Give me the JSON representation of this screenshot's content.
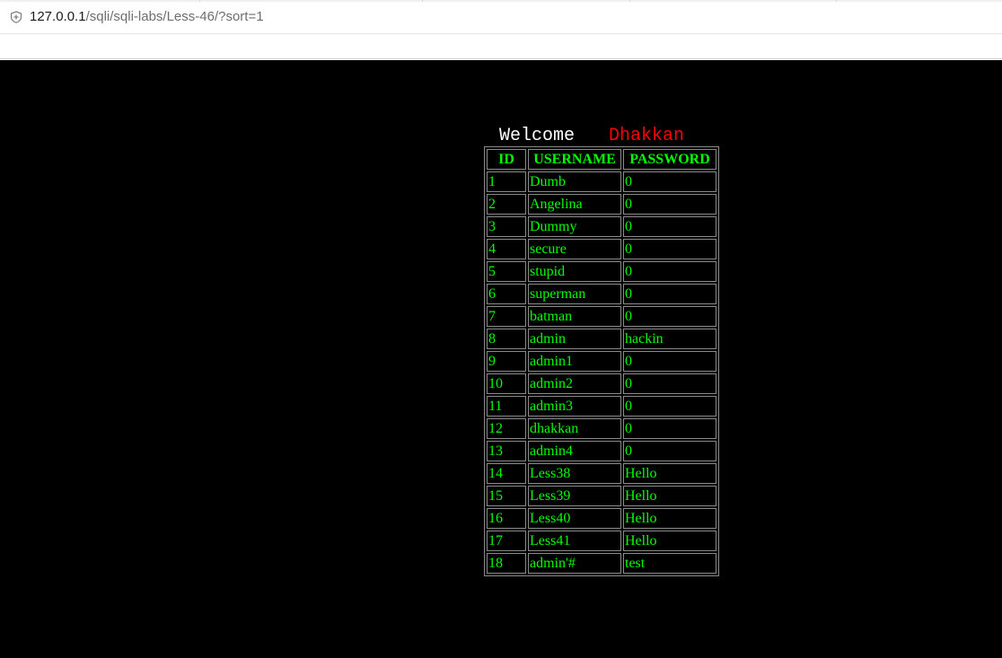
{
  "browser": {
    "address_host": "127.0.0.1",
    "address_path": "/sqli/sqli-labs/Less-46/?sort=1",
    "address_icon": "shield-info-icon"
  },
  "page": {
    "welcome_label": "Welcome",
    "welcome_name": "Dhakkan",
    "colors": {
      "background": "#000000",
      "table_text": "#00ff00",
      "name": "#ff0000",
      "welcome": "#ffffff"
    }
  },
  "table": {
    "headers": [
      "ID",
      "USERNAME",
      "PASSWORD"
    ],
    "rows": [
      [
        "1",
        "Dumb",
        "0"
      ],
      [
        "2",
        "Angelina",
        "0"
      ],
      [
        "3",
        "Dummy",
        "0"
      ],
      [
        "4",
        "secure",
        "0"
      ],
      [
        "5",
        "stupid",
        "0"
      ],
      [
        "6",
        "superman",
        "0"
      ],
      [
        "7",
        "batman",
        "0"
      ],
      [
        "8",
        "admin",
        "hackin"
      ],
      [
        "9",
        "admin1",
        "0"
      ],
      [
        "10",
        "admin2",
        "0"
      ],
      [
        "11",
        "admin3",
        "0"
      ],
      [
        "12",
        "dhakkan",
        "0"
      ],
      [
        "13",
        "admin4",
        "0"
      ],
      [
        "14",
        "Less38",
        "Hello"
      ],
      [
        "15",
        "Less39",
        "Hello"
      ],
      [
        "16",
        "Less40",
        "Hello"
      ],
      [
        "17",
        "Less41",
        "Hello"
      ],
      [
        "18",
        "admin'#",
        "test"
      ]
    ]
  }
}
